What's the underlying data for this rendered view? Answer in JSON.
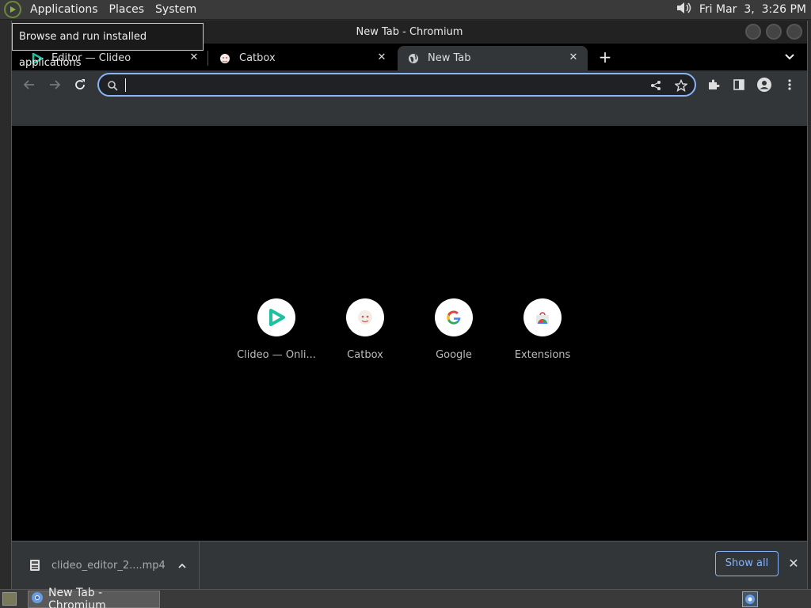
{
  "top_panel": {
    "menus": [
      "Applications",
      "Places",
      "System"
    ],
    "clock": "Fri Mar  3,  3:26 PM"
  },
  "tooltip": "Browse and run installed applications",
  "window": {
    "title": "New Tab - Chromium"
  },
  "tabs": [
    {
      "title": "Editor — Clideo",
      "icon": "clideo-play-icon",
      "active": false
    },
    {
      "title": "Catbox",
      "icon": "catbox-icon",
      "active": false
    },
    {
      "title": "New Tab",
      "icon": "globe-icon",
      "active": true
    }
  ],
  "omnibox": {
    "value": "",
    "placeholder": ""
  },
  "shortcuts": [
    {
      "label": "Clideo — Onli...",
      "icon": "clideo-play-icon"
    },
    {
      "label": "Catbox",
      "icon": "catbox-icon"
    },
    {
      "label": "Google",
      "icon": "google-g-icon"
    },
    {
      "label": "Extensions",
      "icon": "chrome-webstore-icon"
    }
  ],
  "download_bar": {
    "filename": "clideo_editor_2....mp4",
    "show_all_label": "Show all"
  },
  "taskbar": {
    "window_label": "New Tab - Chromium"
  },
  "colors": {
    "accent_blue": "#8ab4f8",
    "toolbar_bg": "#323639",
    "clideo_teal": "#1fc0a0"
  }
}
